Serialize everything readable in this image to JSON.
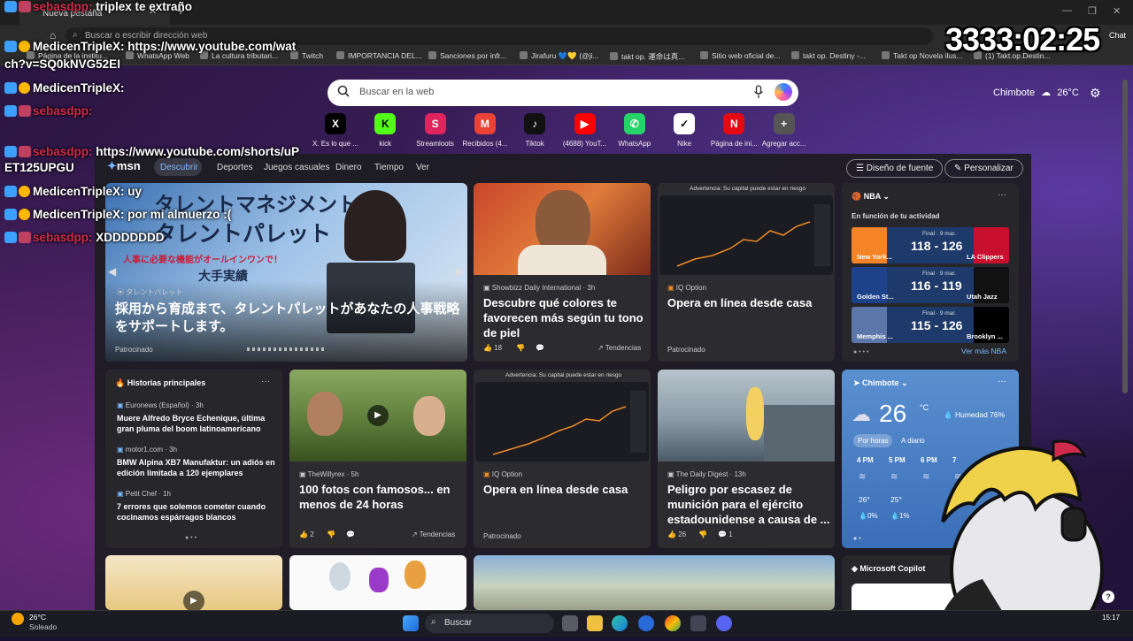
{
  "browser": {
    "tab_title": "Nueva pestaña",
    "address_placeholder": "Buscar o escribir dirección web",
    "bookmarks": [
      "Página de la institu...",
      "WhatsApp Web",
      "La cultura tributari...",
      "Twitch",
      "IMPORTANCIA DEL...",
      "Sanciones por infr...",
      "Jirafuru 💙💛 (@ji...",
      "takt op. 運命は真...",
      "Sitio web oficial de...",
      "takt op. Destiny -...",
      "Takt op Novela ilus...",
      "(1) Takt.op.Destin..."
    ]
  },
  "search": {
    "placeholder": "Buscar en la web"
  },
  "weather_top": {
    "city": "Chimbote",
    "temp": "26°C"
  },
  "quicklinks": [
    {
      "label": "X. Es lo que ...",
      "glyph": "X",
      "color": "#000000"
    },
    {
      "label": "kick",
      "glyph": "K",
      "color": "#53fc18"
    },
    {
      "label": "Streamloots",
      "glyph": "S",
      "color": "#e0245e"
    },
    {
      "label": "Recibidos (4...",
      "glyph": "M",
      "color": "#ea4335"
    },
    {
      "label": "Tiktok",
      "glyph": "♪",
      "color": "#111111"
    },
    {
      "label": "(4688) YouT...",
      "glyph": "▶",
      "color": "#ff0000"
    },
    {
      "label": "WhatsApp",
      "glyph": "✆",
      "color": "#25d366"
    },
    {
      "label": "Nike",
      "glyph": "✓",
      "color": "#ffffff"
    },
    {
      "label": "Página de ini...",
      "glyph": "N",
      "color": "#e50914"
    },
    {
      "label": "Agregar acc...",
      "glyph": "+",
      "color": "#555555"
    }
  ],
  "msn": {
    "logo": "msn",
    "nav": [
      "Descubrir",
      "Deportes",
      "Juegos casuales",
      "Dinero",
      "Tiempo",
      "Ver"
    ],
    "design_btn": "Diseño de fuente",
    "personalize_btn": "Personalizar"
  },
  "hero": {
    "source": "タレントパレット",
    "title": "採用から育成まで、タレントパレットがあなたの人事戦略をサポートします。",
    "jp_big": "タレントマネジメントなら",
    "jp_big2": "タレントパレット",
    "jp_sub": "人事に必要な機能がオールインワンで！",
    "jp_sub2": "大手実績",
    "sponsored": "Patrocinado"
  },
  "card_zendaya": {
    "source": "Showbizz Daily International · 3h",
    "title": "Descubre qué colores te favorecen más según tu tono de piel",
    "likes": "18",
    "trend": "Tendencias"
  },
  "card_iq1": {
    "warning": "Advertencia: Su capital puede estar en riesgo",
    "source": "IQ Option",
    "title": "Opera en línea desde casa",
    "sponsored": "Patrocinado"
  },
  "nba": {
    "league": "NBA",
    "subtitle": "En función de tu actividad",
    "games": [
      {
        "status": "Final · 9 mar.",
        "home": "New York...",
        "score": "118 - 126",
        "away": "LA Clippers",
        "home_color": "#f58426",
        "away_color": "#c8102e"
      },
      {
        "status": "Final · 9 mar.",
        "home": "Golden St...",
        "score": "116 - 119",
        "away": "Utah Jazz",
        "home_color": "#1d428a",
        "away_color": "#111111"
      },
      {
        "status": "Final · 9 mar.",
        "home": "Memphis ...",
        "score": "115 - 126",
        "away": "Brooklyn ...",
        "home_color": "#5d76a9",
        "away_color": "#000000"
      }
    ],
    "more": "Ver más NBA"
  },
  "top_stories": {
    "header": "Historias principales",
    "items": [
      {
        "source": "Euronews (Español) · 3h",
        "title": "Muere Alfredo Bryce Echenique, última gran pluma del boom latinoamericano"
      },
      {
        "source": "motor1.com · 3h",
        "title": "BMW Alpina XB7 Manufaktur: un adiós en edición limitada a 120 ejemplares"
      },
      {
        "source": "Petit Chef · 1h",
        "title": "7 errores que solemos cometer cuando cocinamos espárragos blancos"
      }
    ]
  },
  "card_willyrex": {
    "source": "TheWillyrex · 5h",
    "title": "100 fotos con famosos... en menos de 24 horas",
    "likes": "2",
    "trend": "Tendencias"
  },
  "card_iq2": {
    "warning": "Advertencia: Su capital puede estar en riesgo",
    "source": "IQ Option",
    "title": "Opera en línea desde casa",
    "sponsored": "Patrocinado"
  },
  "card_digest": {
    "source": "The Daily Digest · 13h",
    "title": "Peligro por escasez de munición para el ejército estadounidense a causa de ...",
    "likes": "26",
    "comments": "1"
  },
  "weather": {
    "city": "Chimbote",
    "temp": "26",
    "unit": "°C",
    "humidity": "Humedad 76%",
    "tabs": [
      "Por horas",
      "A diario"
    ],
    "hours": [
      {
        "time": "4 PM",
        "temp": "26°",
        "rain": "0%"
      },
      {
        "time": "5 PM",
        "temp": "25°",
        "rain": "1%"
      },
      {
        "time": "6 PM",
        "temp": "",
        "rain": ""
      },
      {
        "time": "7",
        "temp": "",
        "rain": ""
      }
    ]
  },
  "copilot": {
    "title": "Microsoft Copilot"
  },
  "stream": {
    "timer": "3333:02:25",
    "chat_label": "Chat",
    "messages": [
      {
        "user": "sebasdpp:",
        "text": "triplex te extraño",
        "user_red": true
      },
      {
        "user": "MedicenTripleX:",
        "text": "https://www.youtube.com/wat",
        "user_red": false
      },
      {
        "user": "",
        "text": "ch?v=SQ0kNVG52EI",
        "user_red": false
      },
      {
        "user": "MedicenTripleX:",
        "text": "",
        "user_red": false
      },
      {
        "user": "sebasdpp:",
        "text": "",
        "user_red": true
      },
      {
        "user": "sebasdpp:",
        "text": "https://www.youtube.com/shorts/uP",
        "user_red": true
      },
      {
        "user": "",
        "text": "ET125UPGU",
        "user_red": false
      },
      {
        "user": "MedicenTripleX:",
        "text": "uy",
        "user_red": false
      },
      {
        "user": "MedicenTripleX:",
        "text": "por mi almuerzo :(",
        "user_red": false
      },
      {
        "user": "sebasdpp:",
        "text": "XDDDDDDD",
        "user_red": true
      }
    ]
  },
  "taskbar": {
    "weather_temp": "26°C",
    "weather_desc": "Soleado",
    "search_label": "Buscar",
    "time": "15:17"
  }
}
